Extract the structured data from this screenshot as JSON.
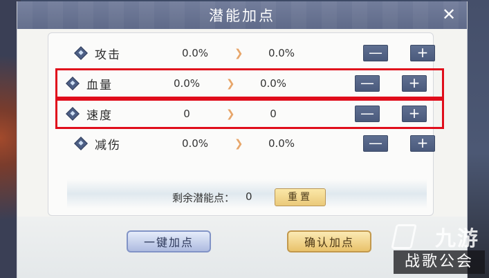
{
  "title": "潜能加点",
  "close_label": "✕",
  "arrow_glyph": "❯",
  "minus_label": "—",
  "plus_label": "+",
  "attributes": [
    {
      "label": "攻击",
      "current": "0.0%",
      "next": "0.0%",
      "highlighted": false
    },
    {
      "label": "血量",
      "current": "0.0%",
      "next": "0.0%",
      "highlighted": true
    },
    {
      "label": "速度",
      "current": "0",
      "next": "0",
      "highlighted": true
    },
    {
      "label": "减伤",
      "current": "0.0%",
      "next": "0.0%",
      "highlighted": false
    }
  ],
  "remaining": {
    "label": "剩余潜能点：",
    "value": "0"
  },
  "reset_label": "重置",
  "oneclick_label": "一键加点",
  "confirm_label": "确认加点",
  "watermark": {
    "top": "九游",
    "bottom": "战歌公会"
  },
  "colors": {
    "highlight": "#e00d1b",
    "title_bar": "#6a7593",
    "confirm": "#e9c26b",
    "oneclick": "#aebbe0"
  }
}
